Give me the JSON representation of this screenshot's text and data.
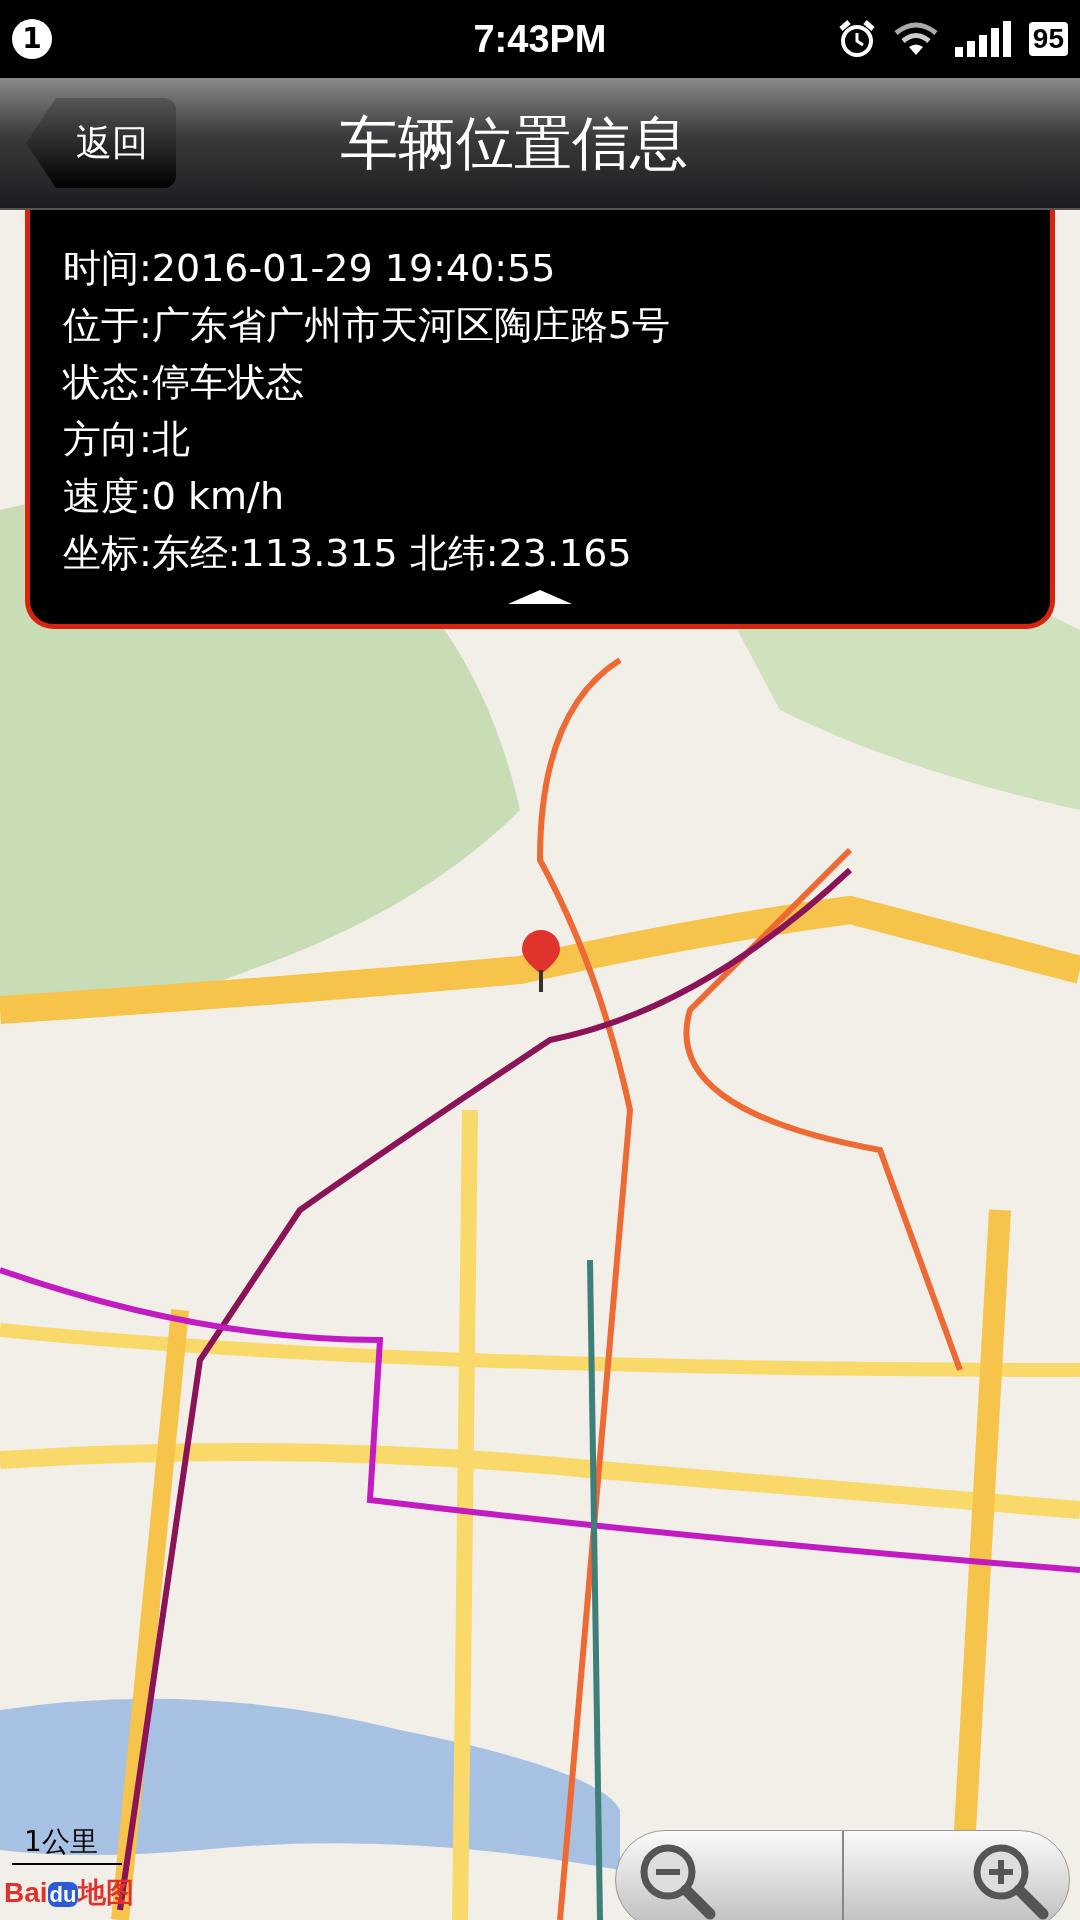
{
  "status_bar": {
    "notification_count": "1",
    "time": "7:43PM",
    "battery": "95"
  },
  "nav_bar": {
    "back_button": "返回",
    "title": "车辆位置信息"
  },
  "info_panel": {
    "expanded": true,
    "lines": [
      "时间:2016-01-29 19:40:55",
      "位于:广东省广州市天河区陶庄路5号",
      "状态:停车状态",
      "方向:北",
      "速度:0 km/h",
      "坐标:东经:113.315 北纬:23.165"
    ]
  },
  "map": {
    "scale": "1公里",
    "logo": {
      "brand": "Bai",
      "brand_highlight": "du",
      "suffix": "地图"
    }
  }
}
